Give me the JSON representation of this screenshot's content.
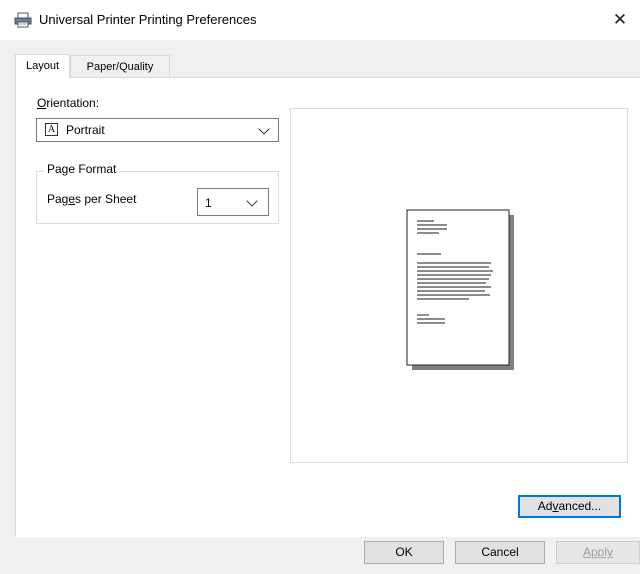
{
  "window": {
    "title": "Universal Printer Printing Preferences",
    "close_glyph": "✕",
    "icon": "printer-icon"
  },
  "tabs": [
    {
      "label": "Layout",
      "active": true
    },
    {
      "label": "Paper/Quality",
      "active": false
    }
  ],
  "orientation": {
    "label_prefix": "O",
    "label_rest": "rientation:",
    "value": "Portrait",
    "icon_letter": "A"
  },
  "page_format": {
    "group_label": "Page Format",
    "pages_label_prefix": "Pag",
    "pages_label_mnemonic": "e",
    "pages_label_rest": "s per Sheet",
    "pages_value": "1"
  },
  "buttons": {
    "advanced_prefix": "Ad",
    "advanced_mnemonic": "v",
    "advanced_rest": "anced...",
    "ok": "OK",
    "cancel": "Cancel",
    "apply": "Apply"
  }
}
